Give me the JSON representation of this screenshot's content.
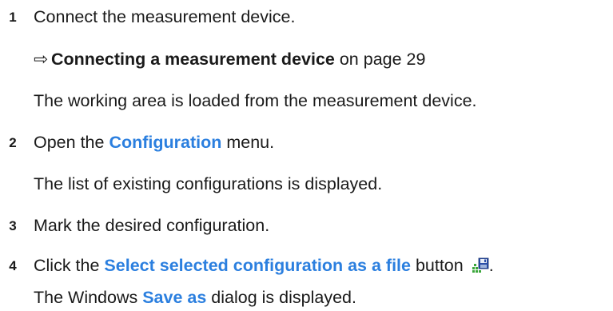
{
  "steps": [
    {
      "number": "1",
      "text": "Connect the measurement device.",
      "xref": {
        "arrow": "⇨",
        "title": "Connecting a measurement device",
        "suffix": " on page 29"
      },
      "result": "The working area is loaded from the measurement device."
    },
    {
      "number": "2",
      "pre": "Open the ",
      "keyword": "Configuration",
      "post": " menu.",
      "result": "The list of existing configurations is displayed."
    },
    {
      "number": "3",
      "text": "Mark the desired configuration."
    },
    {
      "number": "4",
      "pre": "Click the ",
      "keyword": "Select selected configuration as a file",
      "post": " button",
      "trailing": ".",
      "icon": "save-configuration-icon",
      "result_pre": "The Windows ",
      "result_keyword": "Save as",
      "result_post": " dialog is displayed."
    }
  ],
  "colors": {
    "keyword": "#2b7fdf",
    "text": "#1a1a1a"
  }
}
